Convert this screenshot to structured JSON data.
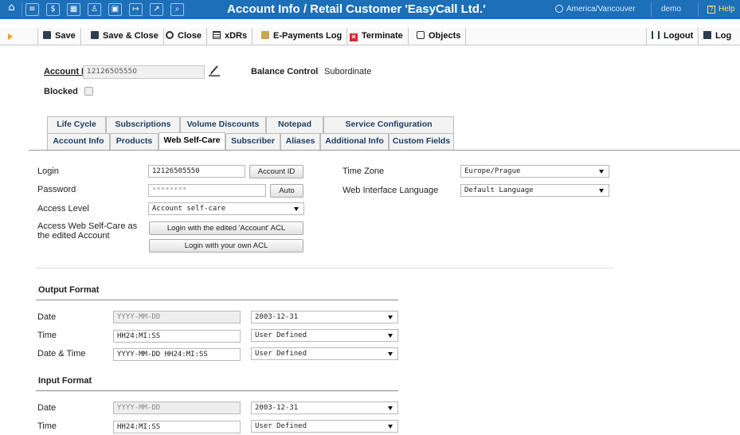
{
  "titlebar": {
    "title": "Account Info / Retail Customer 'EasyCall Ltd.'",
    "timezone": "America/Vancouver",
    "user": "demo",
    "help": "Help",
    "icons": [
      "home-icon",
      "list-icon",
      "dollar-icon",
      "grid-icon",
      "person-icon",
      "apps-icon",
      "export-icon",
      "chart-icon",
      "search-icon"
    ]
  },
  "toolbar": {
    "save": "Save",
    "save_close": "Save & Close",
    "close": "Close",
    "xdrs": "xDRs",
    "epayments": "E-Payments Log",
    "terminate": "Terminate",
    "objects": "Objects",
    "logout": "Logout",
    "log": "Log"
  },
  "account": {
    "id_label": "Account ID",
    "id_value": "12126505550",
    "balance_label": "Balance Control",
    "balance_value": "Subordinate",
    "blocked_label": "Blocked",
    "blocked": false
  },
  "tabs": {
    "row1": [
      "Life Cycle",
      "Subscriptions",
      "Volume Discounts",
      "Notepad",
      "Service Configuration"
    ],
    "row2": [
      "Account Info",
      "Products",
      "Web Self-Care",
      "Subscriber",
      "Aliases",
      "Additional Info",
      "Custom Fields"
    ],
    "active": "Web Self-Care"
  },
  "form": {
    "login_label": "Login",
    "login_value": "12126505550",
    "account_id_button": "Account ID",
    "password_label": "Password",
    "password_value": "********",
    "auto_button": "Auto",
    "access_level_label": "Access Level",
    "access_level_value": "Account self-care",
    "access_wsc_label_1": "Access Web Self-Care as",
    "access_wsc_label_2": "the edited Account",
    "login_edited_button": "Login with the edited 'Account' ACL",
    "login_own_button": "Login with your own ACL",
    "timezone_label": "Time Zone",
    "timezone_value": "Europe/Prague",
    "language_label": "Web Interface Language",
    "language_value": "Default Language"
  },
  "output_format": {
    "title": "Output Format",
    "date_label": "Date",
    "date_value": "YYYY-MM-DD",
    "date_select": "2003-12-31",
    "time_label": "Time",
    "time_value": "HH24:MI:SS",
    "time_select": "User Defined",
    "datetime_label": "Date & Time",
    "datetime_value": "YYYY-MM-DD HH24:MI:SS",
    "datetime_select": "User Defined"
  },
  "input_format": {
    "title": "Input Format",
    "date_label": "Date",
    "date_value": "YYYY-MM-DD",
    "date_select": "2003-12-31",
    "time_label": "Time",
    "time_value": "HH24:MI:SS",
    "time_select": "User Defined"
  }
}
